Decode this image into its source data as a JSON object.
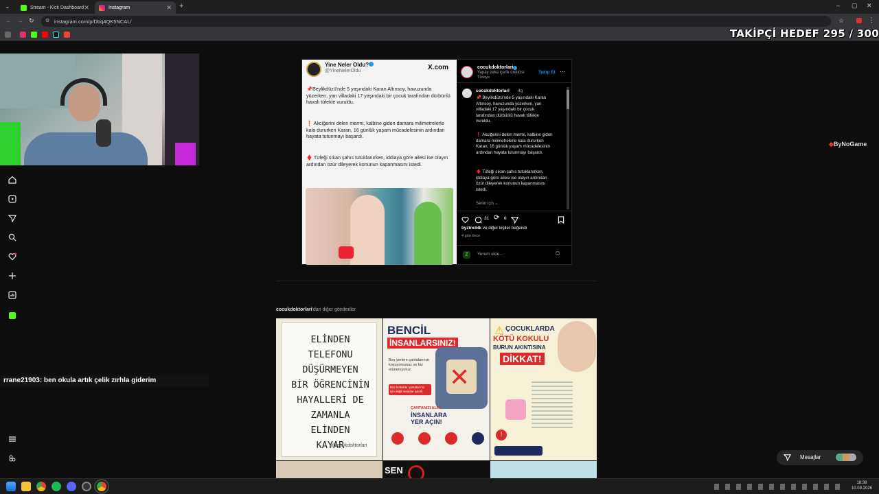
{
  "browser": {
    "tabs": [
      {
        "label": "Stream - Kick Dashboard",
        "color": "#53fc18"
      },
      {
        "label": "Instagram",
        "color": "#e1306c"
      }
    ],
    "url": "instagram.com/p/Dbq4QK5NCAL/"
  },
  "overlay": {
    "follower_goal": "TAKİPÇİ HEDEF 295 / 300",
    "chat_user": "rrane21903",
    "chat_text": ": ben okula artık çelik zırhla giderim",
    "sponsor": "ByNoGame"
  },
  "sidebar": {
    "icons": [
      "home-icon",
      "reels-icon",
      "send-icon",
      "search-icon",
      "heart-icon",
      "plus-icon",
      "dashboard-icon",
      "kick-icon"
    ],
    "bottom_icons": [
      "menu-icon",
      "meta-icon"
    ]
  },
  "post_image": {
    "account": "Yine Neler Oldu?",
    "handle": "@YineNelerOldu",
    "site": "X.com",
    "p1": "📌Beylikdüzü'nde 5 yaşındaki Karan Altınsoy, havuzunda yüzerken, yan villadaki 17 yaşındaki bir çocuk tarafından dürbünlü havalı tüfekle vuruldu.",
    "p2": "❗ Akciğerini delen mermi, kalbine giden damara milimetrelerle kala dururken Karan, 16 günlük yaşam mücadelesinin ardından hayata tutunmayı başardı.",
    "p3": "♦️ Tüfeği sıkan şahıs tutuklanırken, iddiaya göre ailesi ise olayın ardından özür dileyerek konunun kapanmasını istedi."
  },
  "post_side": {
    "username": "cocukdoktorlari",
    "subtitle": "Yapay zeka içerik üreticisi",
    "location": "Türkiye",
    "follow": "Takip Et",
    "caption_user": "cocukdoktorlari",
    "caption_time": "4g",
    "c1": "📌 Beylikdüzü'nde 5 yaşındaki Karan Altınsoy, havuzunda yüzerken, yan villadaki 17 yaşındaki bir çocuk tarafından dürbünlü havalı tüfekle vuruldu.",
    "c2": "❗ Akciğerini delen mermi, kalbine giden damara milimetrelerle kala dururken Karan, 16 günlük yaşam mücadelesinin ardından hayata tutunmayı başardı.",
    "c3": "♦️ Tüfeği sıkan şahıs tutuklanırken, iddiaya göre ailesi ise olayın ardından özür dileyerek konunun kapanmasını istedi.",
    "for_you": "Senin için",
    "comments": "31",
    "reposts": "6",
    "liked_by_user": "byztncblk",
    "liked_by_rest": "ve diğer kişiler beğendi",
    "liked_by_bold": "diğer kişiler",
    "time_ago": "4 gün önce",
    "comment_placeholder": "Yorum ekle..."
  },
  "more_posts": {
    "label_user": "cocukdoktorlari",
    "label_rest": "'dan diğer gönderiler",
    "g1_lines": [
      "ELİNDEN",
      "TELEFONU",
      "DÜŞÜRMEYEN",
      "BİR ÖĞRENCİNİN",
      "HAYALLERİ DE",
      "ZAMANLA",
      "ELİNDEN",
      "KAYAR"
    ],
    "g1_sign": "@cocukdoktorlari",
    "g2_title1": "BENCİL",
    "g2_title2": "İNSANLARSINIZ!",
    "g2_text": "Boş yerlere çantalarınızı koyuyorsunuz ve biz oturamıyoruz.",
    "g2_badge": "Boş koltuklar çantalarınız için değil insanlar içindir.",
    "g2_cta1": "ÇANTANIZI ALIN,",
    "g2_cta2": "İNSANLARA",
    "g2_cta3": "YER AÇIN!",
    "g3_title1": "ÇOCUKLARDA",
    "g3_title2": "KÖTÜ KOKULU",
    "g3_title3": "BURUN AKINTISINA",
    "g3_title4": "DİKKAT!",
    "row2_text": "SEN"
  },
  "messages_label": "Mesajlar",
  "clock": {
    "time": "18:38",
    "date": "10.08.2026"
  }
}
